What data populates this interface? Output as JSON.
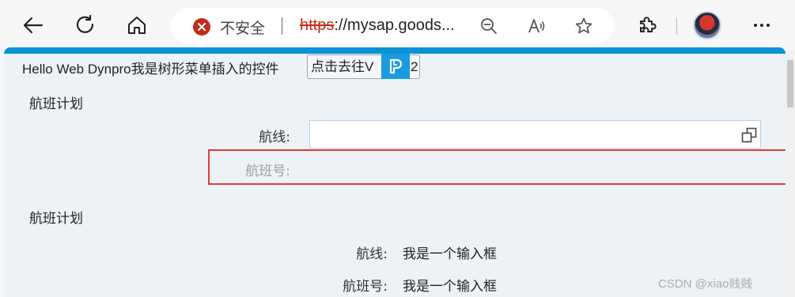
{
  "browser": {
    "security_label": "不安全",
    "url_scheme": "https",
    "url_rest": "://mysap.goods..."
  },
  "page": {
    "hello_text": "Hello Web Dynpro我是树形菜单插入的控件",
    "goto_button_label": "点击去往V",
    "goto_button_suffix": "2",
    "form1": {
      "title": "航班计划",
      "route_label": "航线:",
      "route_value": "",
      "flightno_label": "航班号:"
    },
    "form2": {
      "title": "航班计划",
      "route_label": "航线:",
      "route_value": "我是一个输入框",
      "flightno_label": "航班号:",
      "flightno_value": "我是一个输入框"
    }
  },
  "watermark": "CSDN @xiao贱贱",
  "colors": {
    "accent": "#0a93d6",
    "highlight_border": "#e03a3a",
    "warning": "#c42b1c"
  }
}
